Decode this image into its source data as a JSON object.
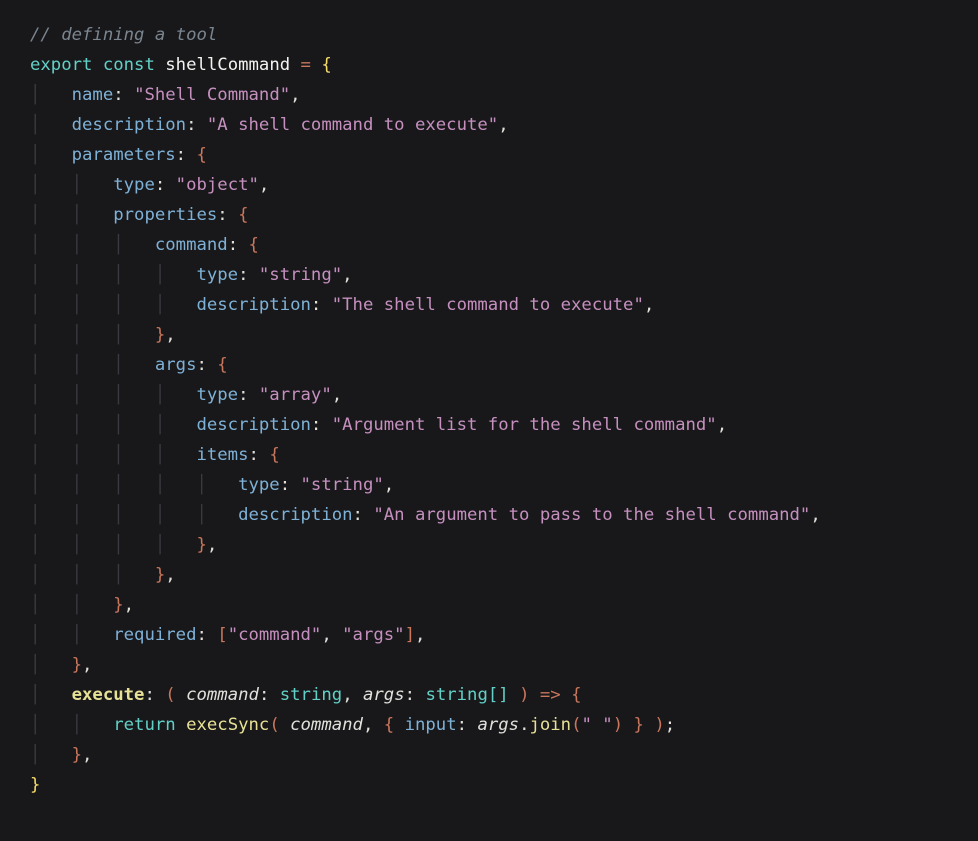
{
  "code": {
    "comment": "// defining a tool",
    "kw_export": "export",
    "kw_const": "const",
    "varname": "shellCommand",
    "eq": "=",
    "k_name": "name",
    "v_name": "\"Shell Command\"",
    "k_desc": "description",
    "v_desc": "\"A shell command to execute\"",
    "k_params": "parameters",
    "k_type": "type",
    "v_object": "\"object\"",
    "k_props": "properties",
    "k_command": "command",
    "v_string": "\"string\"",
    "v_cmddesc": "\"The shell command to execute\"",
    "k_args": "args",
    "v_array": "\"array\"",
    "v_argsdesc": "\"Argument list for the shell command\"",
    "k_items": "items",
    "v_itemdesc": "\"An argument to pass to the shell command\"",
    "k_required": "required",
    "v_req1": "\"command\"",
    "v_req2": "\"args\"",
    "k_exec": "execute",
    "p_command": "command",
    "t_string": "string",
    "p_args": "args",
    "t_stringarr": "string[]",
    "kw_return": "return",
    "fn_execSync": "execSync",
    "k_input": "input",
    "fn_join": "join",
    "v_space": "\" \""
  }
}
